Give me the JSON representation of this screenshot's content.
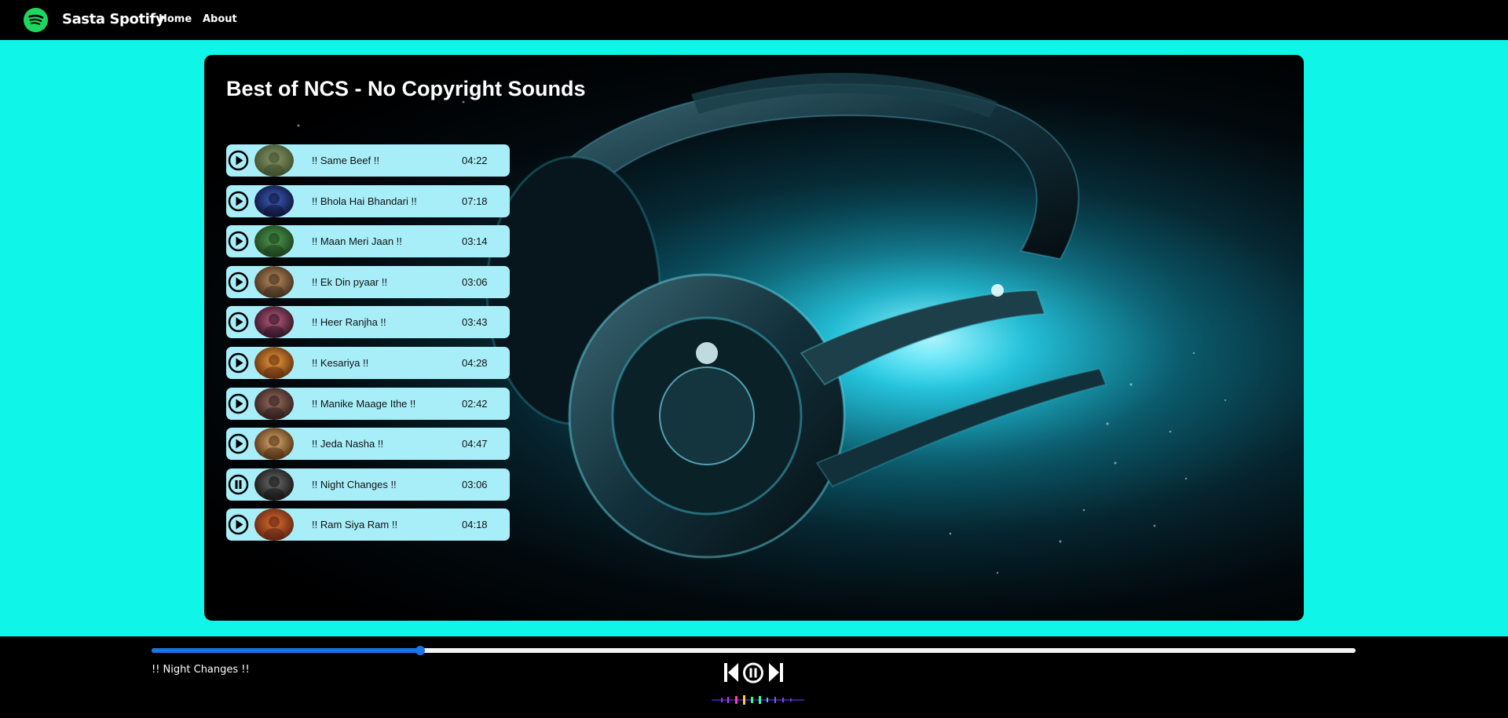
{
  "navbar": {
    "brand": "Sasta Spotify",
    "links": [
      "Home",
      "About"
    ]
  },
  "playlist": {
    "title": "Best of NCS - No Copyright Sounds",
    "songs": [
      {
        "name": "!! Same Beef !!",
        "duration": "04:22",
        "state": "play"
      },
      {
        "name": "!! Bhola Hai Bhandari !!",
        "duration": "07:18",
        "state": "play"
      },
      {
        "name": "!! Maan Meri Jaan !!",
        "duration": "03:14",
        "state": "play"
      },
      {
        "name": "!! Ek Din pyaar !!",
        "duration": "03:06",
        "state": "play"
      },
      {
        "name": "!! Heer Ranjha !!",
        "duration": "03:43",
        "state": "play"
      },
      {
        "name": "!! Kesariya !!",
        "duration": "04:28",
        "state": "play"
      },
      {
        "name": "!! Manike Maage Ithe !!",
        "duration": "02:42",
        "state": "play"
      },
      {
        "name": "!! Jeda Nasha !!",
        "duration": "04:47",
        "state": "play"
      },
      {
        "name": "!! Night Changes !!",
        "duration": "03:06",
        "state": "pause"
      },
      {
        "name": "!! Ram Siya Ram !!",
        "duration": "04:18",
        "state": "play"
      }
    ]
  },
  "player": {
    "now_playing": "!! Night Changes !!",
    "progress_percent": 22.3,
    "controls": [
      "previous-icon",
      "pause-icon",
      "next-icon"
    ]
  },
  "colors": {
    "page_bg": "#0ff5e8",
    "song_item_bg": "#a8eef9",
    "progress_fill": "#1a73e8",
    "brand_green": "#1ed760"
  }
}
